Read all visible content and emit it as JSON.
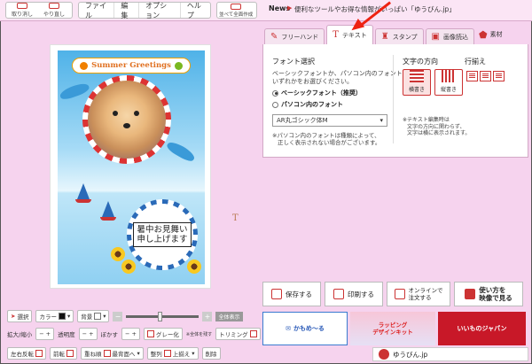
{
  "toolbar": {
    "undo_label": "取り消し",
    "redo_label": "やり直し",
    "menu": [
      "ファイル",
      "編集",
      "オプション",
      "ヘルプ"
    ],
    "fit_label": "並べて全面作成"
  },
  "news": {
    "label": "News",
    "text": "便利なツールやお得な情報がいっぱい「ゆうびん.jp」"
  },
  "card": {
    "banner_text": "Summer Greetings",
    "message_line1": "暑中お見舞い",
    "message_line2": "申し上げます"
  },
  "tabs": [
    {
      "label": "フリーハンド",
      "icon": "pen-icon"
    },
    {
      "label": "テキスト",
      "icon": "text-icon",
      "active": true
    },
    {
      "label": "スタンプ",
      "icon": "stamp-icon"
    },
    {
      "label": "画像読込",
      "icon": "image-icon"
    },
    {
      "label": "素材",
      "icon": "material-icon"
    }
  ],
  "font_panel": {
    "title": "フォント選択",
    "desc_line1": "ベーシックフォントか、パソコン内のフォントの",
    "desc_line2": "いずれかをお選びください。",
    "radio_basic": "ベーシックフォント（推奨）",
    "radio_pc": "パソコン内のフォント",
    "selected_font": "AR丸ゴシック体M",
    "note_line1": "※パソコン内のフォントは種類によって、",
    "note_line2": "正しく表示されない場合がございます。"
  },
  "direction_panel": {
    "title": "文字の方向",
    "horizontal": "横書き",
    "vertical": "縦書き",
    "note_line1": "※テキスト編集時は",
    "note_line2": "文字の方向に関わらず、",
    "note_line3": "文字は横に表示されます。"
  },
  "align_panel": {
    "title": "行揃え"
  },
  "bottom": {
    "select_label": "選択",
    "color_label": "カラー",
    "bg_label": "背景",
    "fullview_label": "全体表示",
    "scale_label": "拡大/縮小",
    "opacity_label": "透明度",
    "blur_label": "ぼかす",
    "glow_label": "グレー化",
    "keep_label": "※全体を残す",
    "trim_label": "トリミング",
    "flip_label": "左右反転",
    "copy_label": "前転",
    "order_label": "重ね順",
    "back_label": "最背面へ",
    "arrange_label": "整列",
    "top_label": "上揃え",
    "delete_label": "削除"
  },
  "actions": {
    "save": "保存する",
    "print": "印刷する",
    "order_line1": "オンラインで",
    "order_line2": "注文する",
    "howto_line1": "使い方を",
    "howto_line2": "映像で見る"
  },
  "ads": {
    "kamome": "かもめ～る",
    "wrapping_line1": "ラッピング",
    "wrapping_line2": "デザインキット",
    "japan": "いいものジャパン"
  },
  "footer": {
    "label": "ゆうびん.jp"
  },
  "colors": {
    "accent": "#cc3333",
    "background": "#f6d3ee"
  }
}
